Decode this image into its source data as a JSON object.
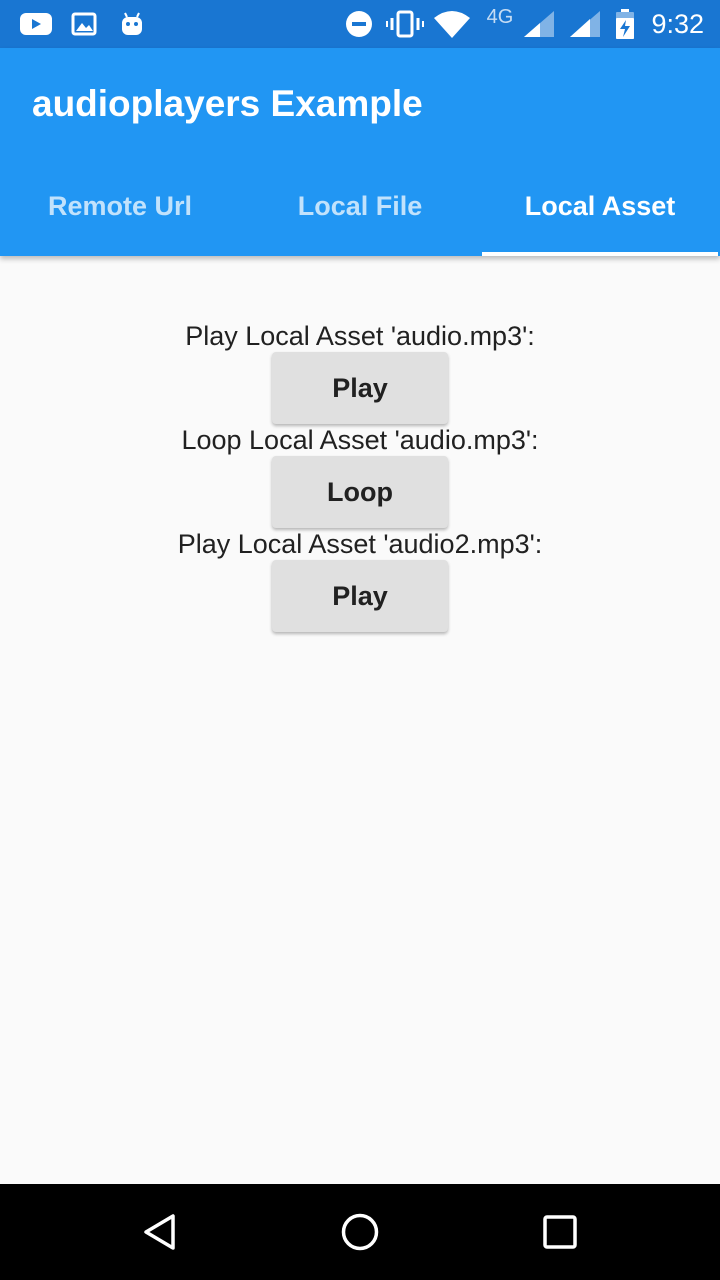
{
  "status_bar": {
    "time": "9:32",
    "network": "4G",
    "left_icons": [
      "youtube-icon",
      "gallery-icon",
      "android-icon"
    ],
    "right_icons": [
      "do-not-disturb-icon",
      "vibrate-icon",
      "wifi-icon",
      "signal-icon",
      "signal-icon-2",
      "battery-charging-icon"
    ]
  },
  "app_bar": {
    "title": "audioplayers Example",
    "color": "#2196f3",
    "status_color": "#1976d2"
  },
  "tabs": [
    {
      "label": "Remote Url",
      "active": false
    },
    {
      "label": "Local File",
      "active": false
    },
    {
      "label": "Local Asset",
      "active": true
    }
  ],
  "content": {
    "rows": [
      {
        "label": "Play Local  Asset 'audio.mp3':",
        "button": "Play"
      },
      {
        "label": "Loop Local  Asset 'audio.mp3':",
        "button": "Loop"
      },
      {
        "label": "Play Local  Asset 'audio2.mp3':",
        "button": "Play"
      }
    ]
  },
  "nav_bar": {
    "buttons": [
      "back-icon",
      "home-icon",
      "recents-icon"
    ]
  }
}
